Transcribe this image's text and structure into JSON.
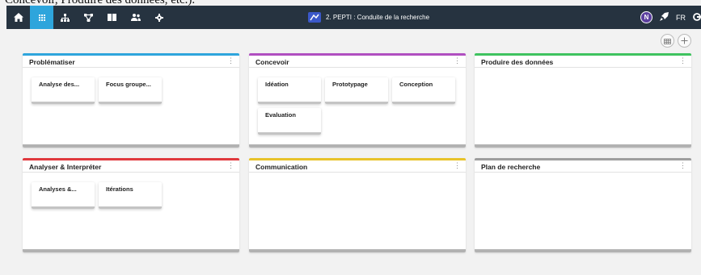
{
  "cut_text": "Concevoir, Produire des données, etc.).",
  "nav": {
    "items": [
      {
        "name": "home",
        "icon": "home-icon"
      },
      {
        "name": "grid",
        "icon": "grid-icon",
        "active": true
      },
      {
        "name": "sitemap",
        "icon": "sitemap-icon"
      },
      {
        "name": "network",
        "icon": "network-icon"
      },
      {
        "name": "book",
        "icon": "book-icon"
      },
      {
        "name": "users",
        "icon": "users-icon"
      },
      {
        "name": "settings",
        "icon": "gear-icon"
      }
    ]
  },
  "project": {
    "title": "2. PEPTI : Conduite de la recherche",
    "icon": "project-icon"
  },
  "user": {
    "avatar_letter": "N",
    "language": "FR"
  },
  "colors": {
    "topbar": "#263340",
    "active_nav": "#2ea5dc",
    "problematiser": "#2ea5dc",
    "concevoir": "#b04fc0",
    "produire": "#3fc35f",
    "analyser": "#e0393e",
    "communication": "#e8c32a",
    "plan": "#9e9e9e"
  },
  "panels": [
    {
      "title": "Problématiser",
      "accent": "#2ea5dc",
      "cards": [
        "Analyse des...",
        "Focus groupe..."
      ]
    },
    {
      "title": "Concevoir",
      "accent": "#b04fc0",
      "cards": [
        "Idéation",
        "Prototypage",
        "Conception",
        "Evaluation"
      ]
    },
    {
      "title": "Produire des données",
      "accent": "#3fc35f",
      "cards": []
    },
    {
      "title": "Analyser & Interpréter",
      "accent": "#e0393e",
      "cards": [
        "Analyses &...",
        "Itérations"
      ]
    },
    {
      "title": "Communication",
      "accent": "#e8c32a",
      "cards": []
    },
    {
      "title": "Plan de recherche",
      "accent": "#9e9e9e",
      "cards": []
    }
  ]
}
